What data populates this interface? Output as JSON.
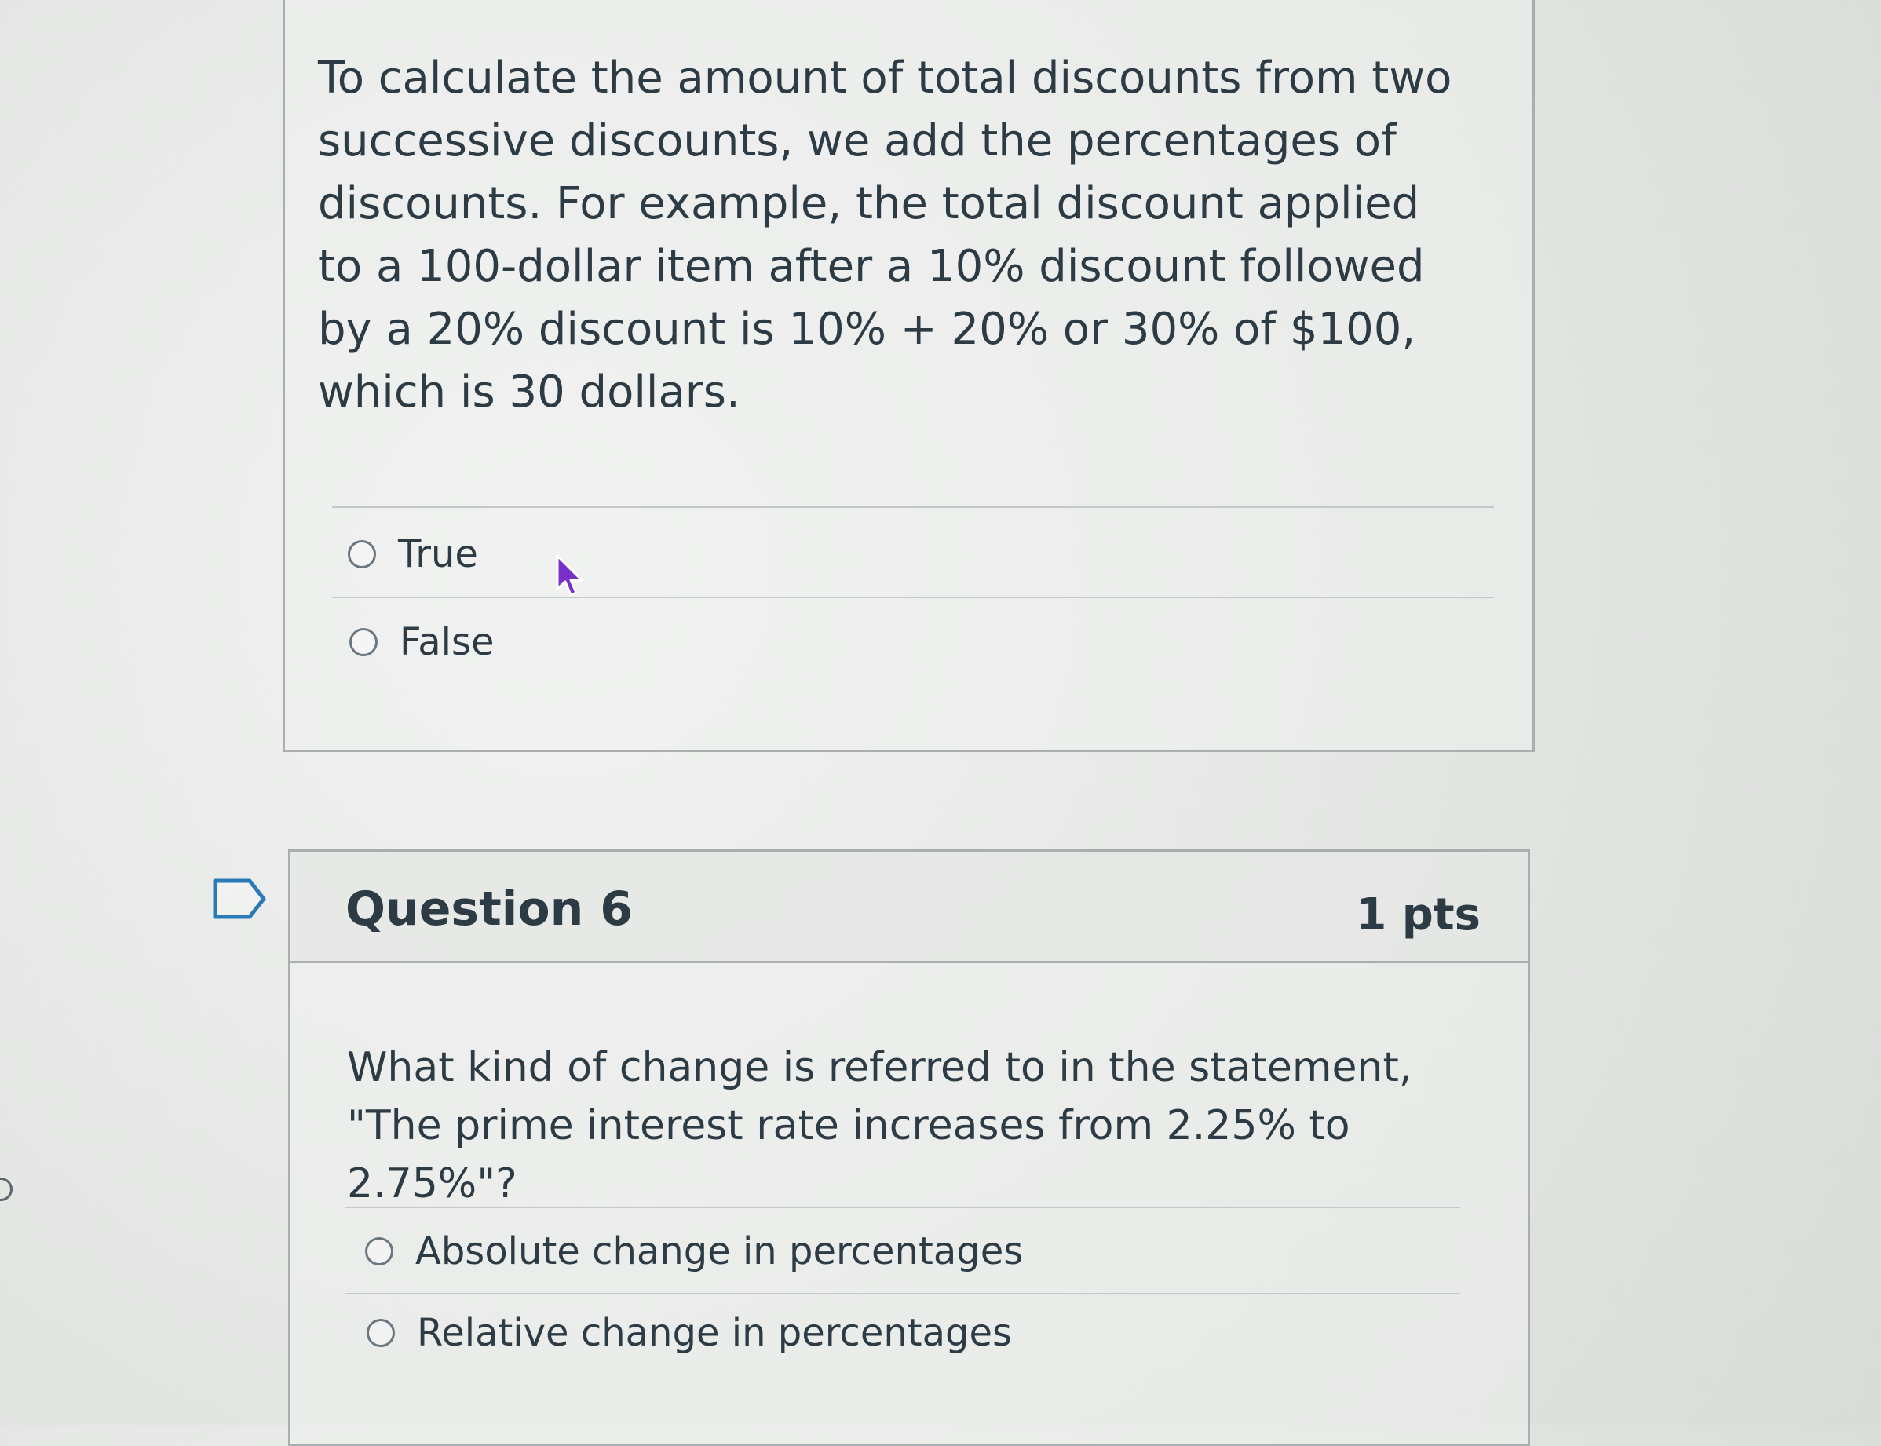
{
  "question5": {
    "stem": "To calculate the amount of total discounts from two successive discounts, we add the percentages of discounts. For example, the total discount applied to a 100-dollar item after a 10% discount followed by a 20% discount is 10% + 20% or 30% of $100, which is 30 dollars.",
    "answers": [
      {
        "label": "True"
      },
      {
        "label": "False"
      }
    ]
  },
  "question6": {
    "title": "Question 6",
    "points": "1 pts",
    "stem": "What kind of change is referred to in the statement, \"The prime interest rate increases from 2.25% to 2.75%\"?",
    "answers": [
      {
        "label": "Absolute change in percentages"
      },
      {
        "label": "Relative change in percentages"
      }
    ]
  },
  "icons": {
    "flag": "flag-icon",
    "cursor": "mouse-pointer-icon",
    "radio": "radio-button-icon"
  },
  "colors": {
    "text": "#2d3b45",
    "border": "#a9aeb0",
    "cursor": "#7b2fc9"
  }
}
